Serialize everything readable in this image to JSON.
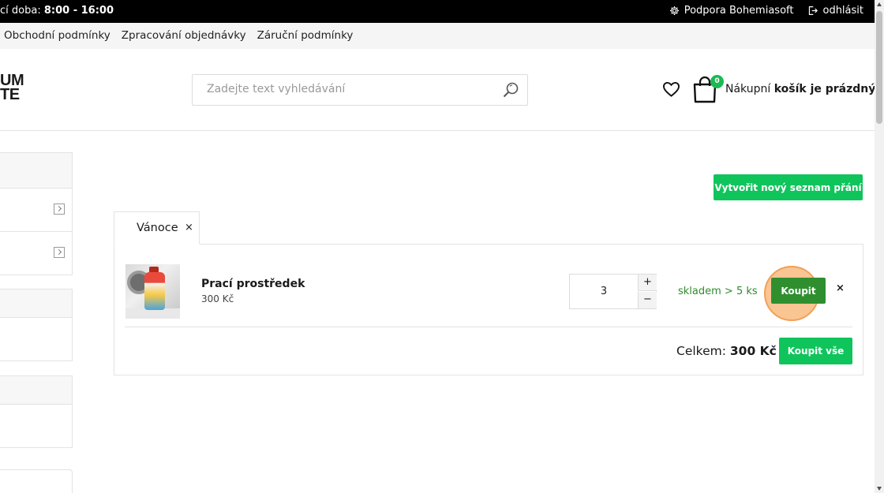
{
  "topbar": {
    "hours_label": "cí doba:",
    "hours_value": "8:00 - 16:00",
    "support_label": "Podpora Bohemiasoft",
    "logout_label": "odhlásit"
  },
  "nav": {
    "items": [
      {
        "label": "Obchodní podmínky"
      },
      {
        "label": "Zpracování objednávky"
      },
      {
        "label": "Záruční podmínky"
      }
    ]
  },
  "header": {
    "logo_line1": "UM",
    "logo_line2": "TE",
    "search_placeholder": "Zadejte text vyhledávání",
    "cart_count": "0",
    "cart_prefix": "Nákupní",
    "cart_state": "košík je prázdný"
  },
  "wishlist": {
    "new_list_button": "Vytvořit nový seznam přání",
    "tab_label": "Vánoce",
    "tab_close": "×",
    "items": [
      {
        "name": "Prací prostředek",
        "price": "300 Kč",
        "quantity": "3",
        "stock": "skladem > 5 ks",
        "buy_label": "Koupit",
        "remove": "×"
      }
    ],
    "total_label": "Celkem:",
    "total_value": "300 Kč",
    "buy_all_label": "Koupit vše"
  },
  "colors": {
    "accent_green": "#10c45c",
    "buy_green": "#2f8f2f",
    "stock_green": "#2e8b2e",
    "highlight_orange": "#f2a057"
  },
  "icons": [
    "gear-icon",
    "logout-icon",
    "search-icon",
    "heart-icon",
    "cart-bag-icon",
    "close-icon",
    "plus-icon",
    "minus-icon",
    "chevron-right-icon"
  ]
}
